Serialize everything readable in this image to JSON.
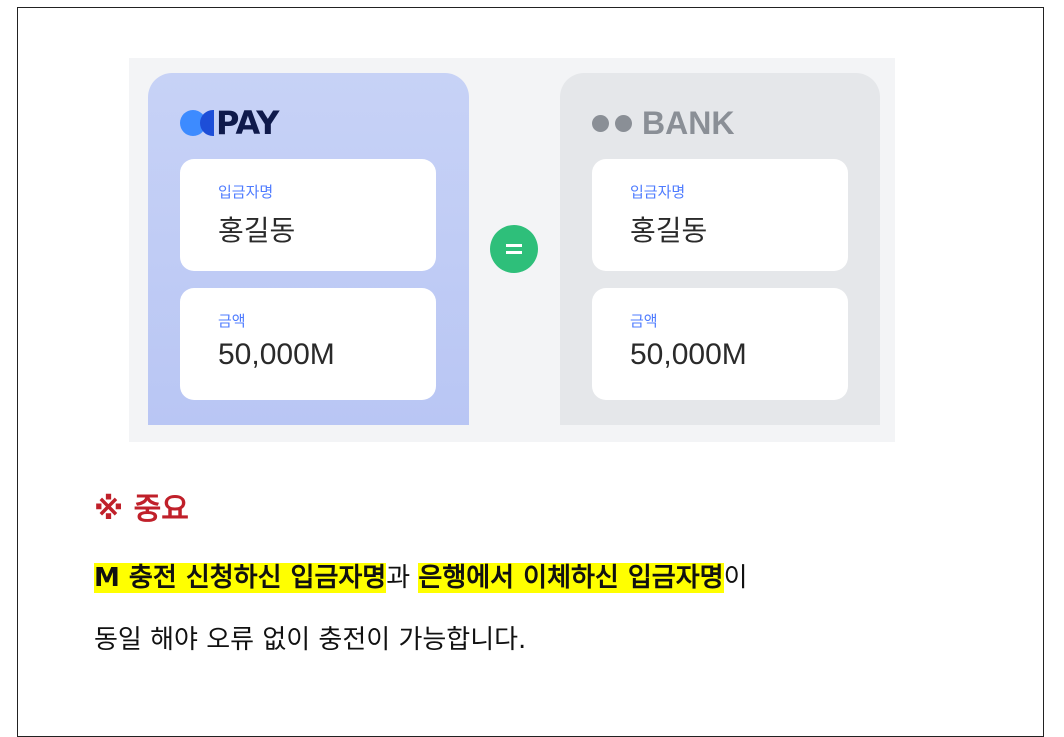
{
  "colors": {
    "accent_blue": "#4f7cff",
    "important_red": "#c0202a",
    "equal_green": "#2ebf7a",
    "highlight_yellow": "#ffff00"
  },
  "pay_card": {
    "brand": "PAY",
    "name_label": "입금자명",
    "name_value": "홍길동",
    "amount_label": "금액",
    "amount_value": "50,000M"
  },
  "bank_card": {
    "brand": "BANK",
    "name_label": "입금자명",
    "name_value": "홍길동",
    "amount_label": "금액",
    "amount_value": "50,000M"
  },
  "equal_symbol": "=",
  "notice": {
    "heading": "※ 중요",
    "line1_part1": "M 충전 신청하신 입금자명",
    "line1_part2": "과 ",
    "line1_part3": "은행에서 이체하신 입금자명",
    "line1_part4": "이",
    "line2": "동일 해야 오류 없이 충전이 가능합니다."
  }
}
